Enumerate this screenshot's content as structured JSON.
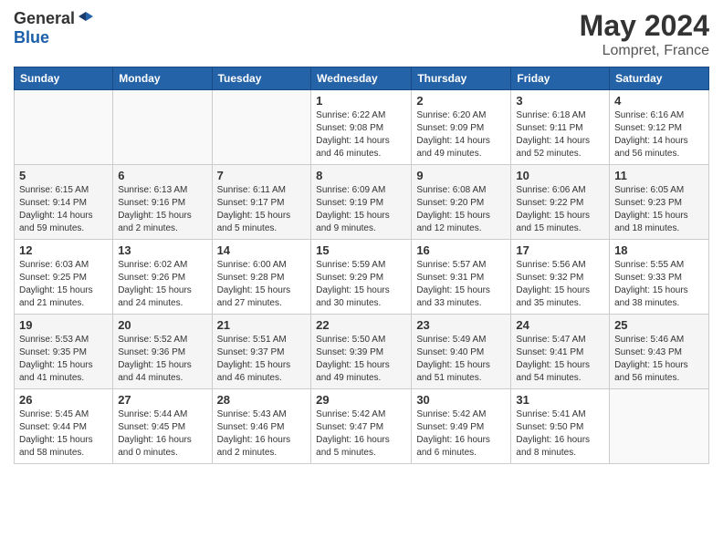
{
  "header": {
    "logo_general": "General",
    "logo_blue": "Blue",
    "month_title": "May 2024",
    "location": "Lompret, France"
  },
  "days_of_week": [
    "Sunday",
    "Monday",
    "Tuesday",
    "Wednesday",
    "Thursday",
    "Friday",
    "Saturday"
  ],
  "weeks": [
    [
      {
        "day": "",
        "info": ""
      },
      {
        "day": "",
        "info": ""
      },
      {
        "day": "",
        "info": ""
      },
      {
        "day": "1",
        "info": "Sunrise: 6:22 AM\nSunset: 9:08 PM\nDaylight: 14 hours and 46 minutes."
      },
      {
        "day": "2",
        "info": "Sunrise: 6:20 AM\nSunset: 9:09 PM\nDaylight: 14 hours and 49 minutes."
      },
      {
        "day": "3",
        "info": "Sunrise: 6:18 AM\nSunset: 9:11 PM\nDaylight: 14 hours and 52 minutes."
      },
      {
        "day": "4",
        "info": "Sunrise: 6:16 AM\nSunset: 9:12 PM\nDaylight: 14 hours and 56 minutes."
      }
    ],
    [
      {
        "day": "5",
        "info": "Sunrise: 6:15 AM\nSunset: 9:14 PM\nDaylight: 14 hours and 59 minutes."
      },
      {
        "day": "6",
        "info": "Sunrise: 6:13 AM\nSunset: 9:16 PM\nDaylight: 15 hours and 2 minutes."
      },
      {
        "day": "7",
        "info": "Sunrise: 6:11 AM\nSunset: 9:17 PM\nDaylight: 15 hours and 5 minutes."
      },
      {
        "day": "8",
        "info": "Sunrise: 6:09 AM\nSunset: 9:19 PM\nDaylight: 15 hours and 9 minutes."
      },
      {
        "day": "9",
        "info": "Sunrise: 6:08 AM\nSunset: 9:20 PM\nDaylight: 15 hours and 12 minutes."
      },
      {
        "day": "10",
        "info": "Sunrise: 6:06 AM\nSunset: 9:22 PM\nDaylight: 15 hours and 15 minutes."
      },
      {
        "day": "11",
        "info": "Sunrise: 6:05 AM\nSunset: 9:23 PM\nDaylight: 15 hours and 18 minutes."
      }
    ],
    [
      {
        "day": "12",
        "info": "Sunrise: 6:03 AM\nSunset: 9:25 PM\nDaylight: 15 hours and 21 minutes."
      },
      {
        "day": "13",
        "info": "Sunrise: 6:02 AM\nSunset: 9:26 PM\nDaylight: 15 hours and 24 minutes."
      },
      {
        "day": "14",
        "info": "Sunrise: 6:00 AM\nSunset: 9:28 PM\nDaylight: 15 hours and 27 minutes."
      },
      {
        "day": "15",
        "info": "Sunrise: 5:59 AM\nSunset: 9:29 PM\nDaylight: 15 hours and 30 minutes."
      },
      {
        "day": "16",
        "info": "Sunrise: 5:57 AM\nSunset: 9:31 PM\nDaylight: 15 hours and 33 minutes."
      },
      {
        "day": "17",
        "info": "Sunrise: 5:56 AM\nSunset: 9:32 PM\nDaylight: 15 hours and 35 minutes."
      },
      {
        "day": "18",
        "info": "Sunrise: 5:55 AM\nSunset: 9:33 PM\nDaylight: 15 hours and 38 minutes."
      }
    ],
    [
      {
        "day": "19",
        "info": "Sunrise: 5:53 AM\nSunset: 9:35 PM\nDaylight: 15 hours and 41 minutes."
      },
      {
        "day": "20",
        "info": "Sunrise: 5:52 AM\nSunset: 9:36 PM\nDaylight: 15 hours and 44 minutes."
      },
      {
        "day": "21",
        "info": "Sunrise: 5:51 AM\nSunset: 9:37 PM\nDaylight: 15 hours and 46 minutes."
      },
      {
        "day": "22",
        "info": "Sunrise: 5:50 AM\nSunset: 9:39 PM\nDaylight: 15 hours and 49 minutes."
      },
      {
        "day": "23",
        "info": "Sunrise: 5:49 AM\nSunset: 9:40 PM\nDaylight: 15 hours and 51 minutes."
      },
      {
        "day": "24",
        "info": "Sunrise: 5:47 AM\nSunset: 9:41 PM\nDaylight: 15 hours and 54 minutes."
      },
      {
        "day": "25",
        "info": "Sunrise: 5:46 AM\nSunset: 9:43 PM\nDaylight: 15 hours and 56 minutes."
      }
    ],
    [
      {
        "day": "26",
        "info": "Sunrise: 5:45 AM\nSunset: 9:44 PM\nDaylight: 15 hours and 58 minutes."
      },
      {
        "day": "27",
        "info": "Sunrise: 5:44 AM\nSunset: 9:45 PM\nDaylight: 16 hours and 0 minutes."
      },
      {
        "day": "28",
        "info": "Sunrise: 5:43 AM\nSunset: 9:46 PM\nDaylight: 16 hours and 2 minutes."
      },
      {
        "day": "29",
        "info": "Sunrise: 5:42 AM\nSunset: 9:47 PM\nDaylight: 16 hours and 5 minutes."
      },
      {
        "day": "30",
        "info": "Sunrise: 5:42 AM\nSunset: 9:49 PM\nDaylight: 16 hours and 6 minutes."
      },
      {
        "day": "31",
        "info": "Sunrise: 5:41 AM\nSunset: 9:50 PM\nDaylight: 16 hours and 8 minutes."
      },
      {
        "day": "",
        "info": ""
      }
    ]
  ]
}
